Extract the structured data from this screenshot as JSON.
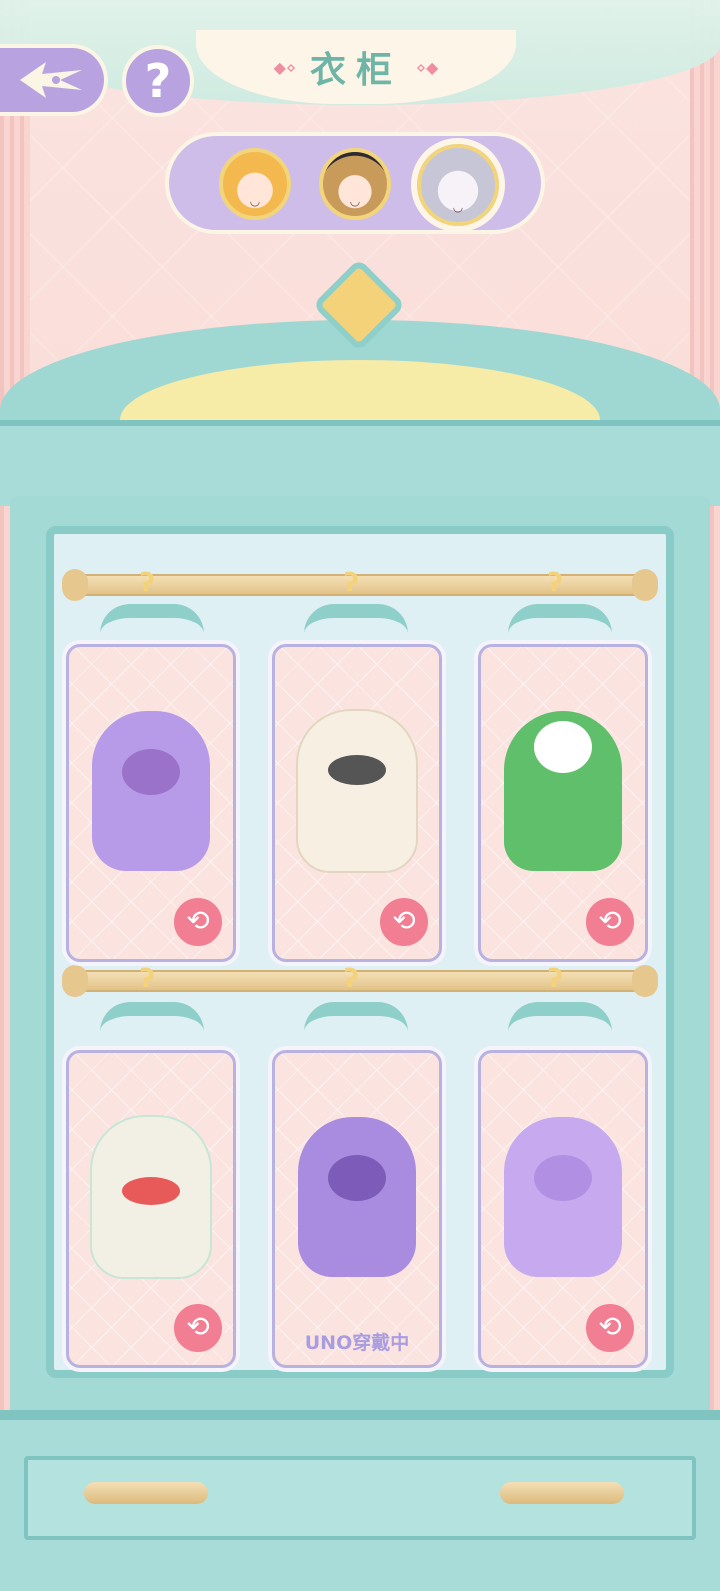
{
  "header": {
    "title": "衣柜",
    "back_icon": "back-arrow-icon",
    "help_label": "?"
  },
  "characters": [
    {
      "name": "blonde-girl",
      "selected": false
    },
    {
      "name": "brown-hair-hat",
      "selected": false
    },
    {
      "name": "silver-hair",
      "selected": true
    }
  ],
  "wardrobe": {
    "items": [
      {
        "costume": "purple cat hoodie",
        "color": "#b79be8",
        "action_icon": "swap-icon"
      },
      {
        "costume": "mummy bandage",
        "color": "#f6efe2",
        "action_icon": "swap-icon"
      },
      {
        "costume": "snowman christmas tree",
        "color": "#5fbf6a",
        "action_icon": "swap-icon"
      },
      {
        "costume": "lion dance",
        "color": "#f2efe4",
        "action_icon": "swap-icon"
      },
      {
        "costume": "purple devil",
        "color": "#a98be0",
        "wearing_label": "UNO穿戴中"
      },
      {
        "costume": "purple hamster",
        "color": "#c6a9ef",
        "action_icon": "swap-icon"
      }
    ]
  },
  "colors": {
    "accent": "#b8a3e0",
    "wardrobe": "#a3dad6",
    "swap": "#f27e93",
    "title": "#6fb5a7"
  }
}
